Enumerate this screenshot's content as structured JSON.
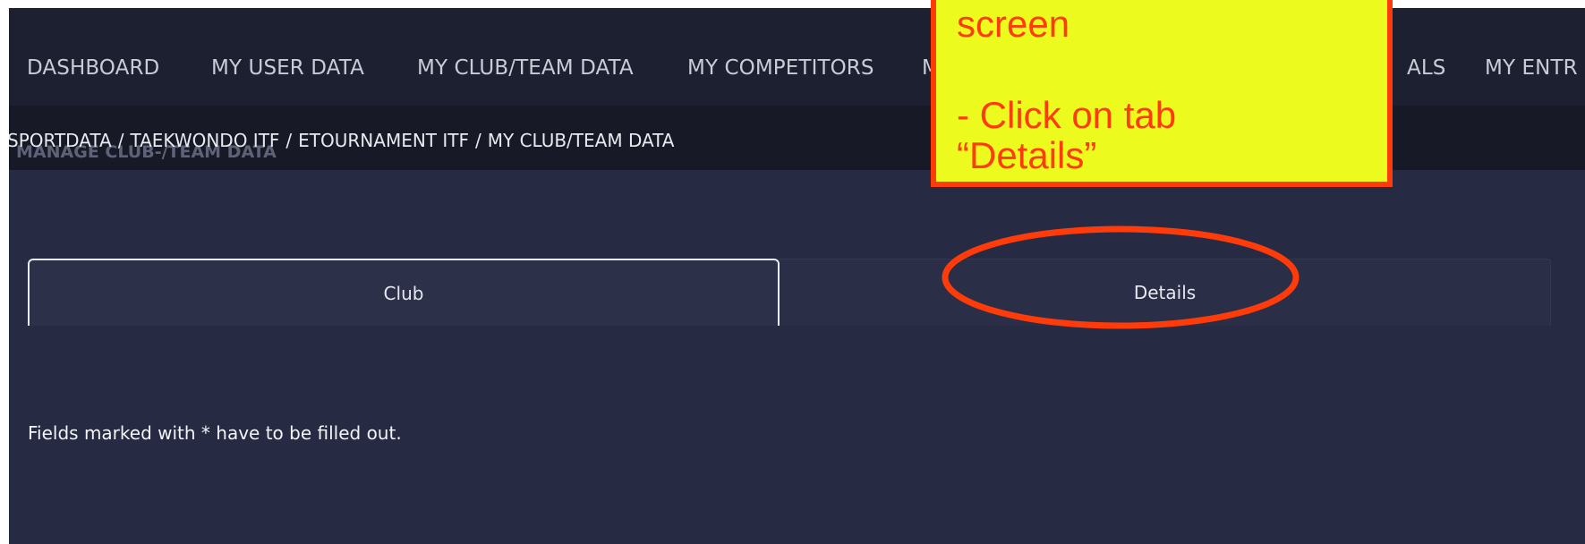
{
  "nav": {
    "items": [
      {
        "label": "DASHBOARD"
      },
      {
        "label": "MY USER DATA"
      },
      {
        "label": "MY CLUB/TEAM DATA"
      },
      {
        "label": "MY COMPETITORS"
      },
      {
        "label": "M"
      },
      {
        "label": "ALS"
      },
      {
        "label": "MY ENTR"
      }
    ]
  },
  "page_subtitle": "MANAGE CLUB-/TEAM DATA",
  "breadcrumb": {
    "items": [
      "SPORTDATA",
      "TAEKWONDO ITF",
      "ETOURNAMENT ITF",
      "MY CLUB/TEAM DATA"
    ],
    "separator": "/"
  },
  "tabs": [
    {
      "label": "Club",
      "active": true
    },
    {
      "label": "Details",
      "active": false
    }
  ],
  "form_hint": "Fields marked with * have to be filled out.",
  "callout": {
    "lines": [
      "screen",
      "- Click on tab",
      "“Details”"
    ]
  },
  "colors": {
    "app_bg": "#262a43",
    "nav_bg": "#1d2031",
    "breadcrumb_bg": "#171a26",
    "callout_bg": "#ecfa1e",
    "annotation": "#ff3b0a"
  }
}
